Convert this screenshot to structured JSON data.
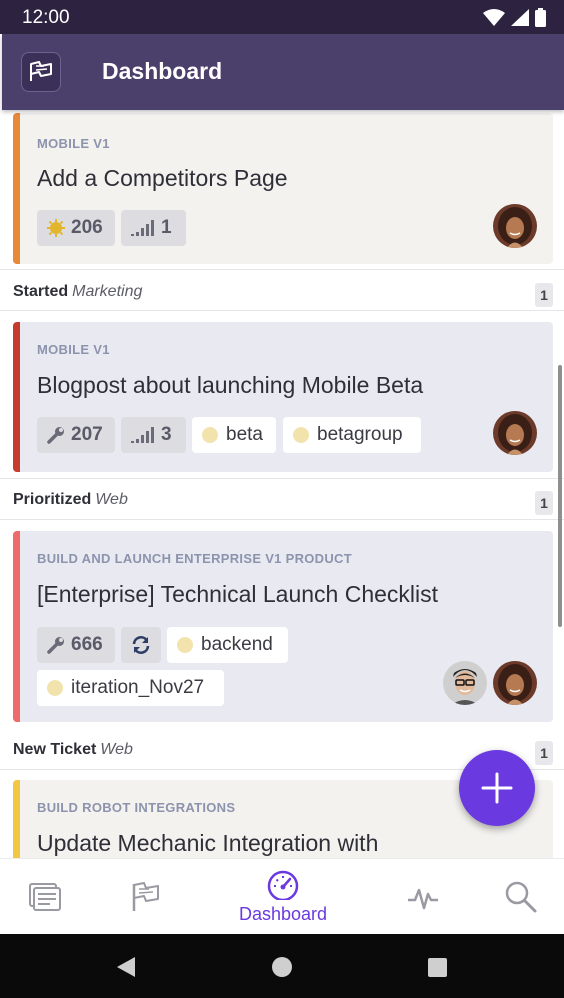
{
  "status_bar": {
    "time": "12:00"
  },
  "header": {
    "title": "Dashboard"
  },
  "sections": [
    {
      "name": "Started",
      "type": "Marketing",
      "count": "1"
    },
    {
      "name": "Prioritized",
      "type": "Web",
      "count": "1"
    },
    {
      "name": "New Ticket",
      "type": "Web",
      "count": "1"
    }
  ],
  "cards": [
    {
      "project": "MOBILE V1",
      "title": "Add a Competitors Page",
      "accent_color": "#e8893a",
      "background": "#f4f2ef",
      "id_chip": "206",
      "id_icon": "bug-icon",
      "priority": "1"
    },
    {
      "project": "MOBILE V1",
      "title": "Blogpost about launching Mobile Beta",
      "accent_color": "#c73a2e",
      "background": "#e9eaf1",
      "id_chip": "207",
      "id_icon": "wrench-icon",
      "priority": "3",
      "labels": [
        "beta",
        "betagroup"
      ]
    },
    {
      "project": "BUILD AND LAUNCH ENTERPRISE V1 PRODUCT",
      "title": "[Enterprise] Technical Launch Checklist",
      "accent_color": "#ee6b6b",
      "background": "#e9eaf1",
      "id_chip": "666",
      "id_icon": "wrench-icon",
      "labels": [
        "backend",
        "iteration_Nov27"
      ]
    },
    {
      "project": "BUILD ROBOT INTEGRATIONS",
      "title": "Update Mechanic Integration with",
      "accent_color": "#f2c744",
      "background": "#f4f2ef"
    }
  ],
  "bottom_nav": {
    "items": [
      "stories-icon",
      "epics-flag-icon",
      "dashboard-icon",
      "activity-icon",
      "search-icon"
    ],
    "active_label": "Dashboard",
    "active_color": "#6a39e0"
  },
  "fab": {
    "icon": "plus-icon",
    "color": "#6a39e0"
  }
}
